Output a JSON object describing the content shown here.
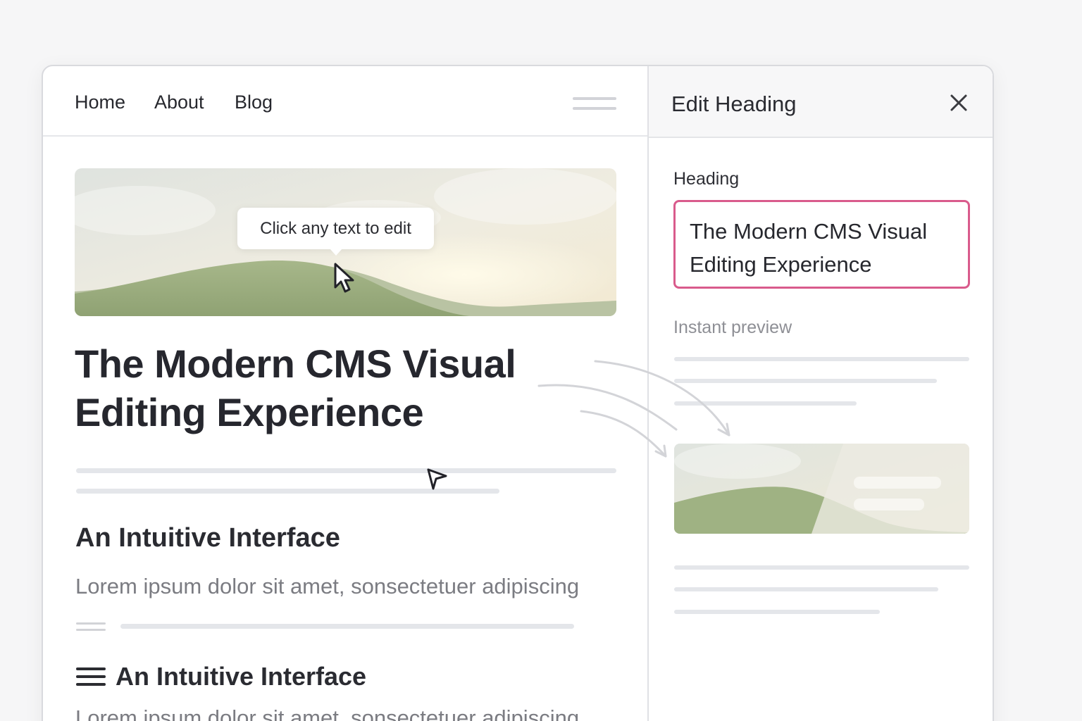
{
  "site": {
    "nav": {
      "items": [
        {
          "label": "Home"
        },
        {
          "label": "About"
        },
        {
          "label": "Blog"
        }
      ]
    },
    "hero": {
      "tooltip": "Click any text to edit"
    },
    "heading": "The Modern CMS Visual Editing Experience",
    "section": {
      "title": "An Intuitive Interface",
      "body": "Lorem ipsum dolor sit amet, sonsectetuer adipiscing"
    },
    "section2": {
      "title": "An Intuitive Interface",
      "body": "Lorem ipsum dolor sit amet, sonsectetuer adipiscing"
    }
  },
  "editor": {
    "title": "Edit Heading",
    "field_label": "Heading",
    "field_value": "The Modern CMS Visual Editing Experience",
    "preview_label": "Instant preview"
  },
  "icons": {
    "close": "close-icon",
    "hamburger": "hamburger-icon",
    "cursor": "mouse-pointer-icon",
    "drag": "drag-handle-icon",
    "menu": "menu-icon"
  },
  "colors": {
    "input_border": "#d95b8c",
    "text_primary": "#26272d",
    "text_muted": "#7b7c82",
    "skeleton": "#e4e6ea"
  }
}
